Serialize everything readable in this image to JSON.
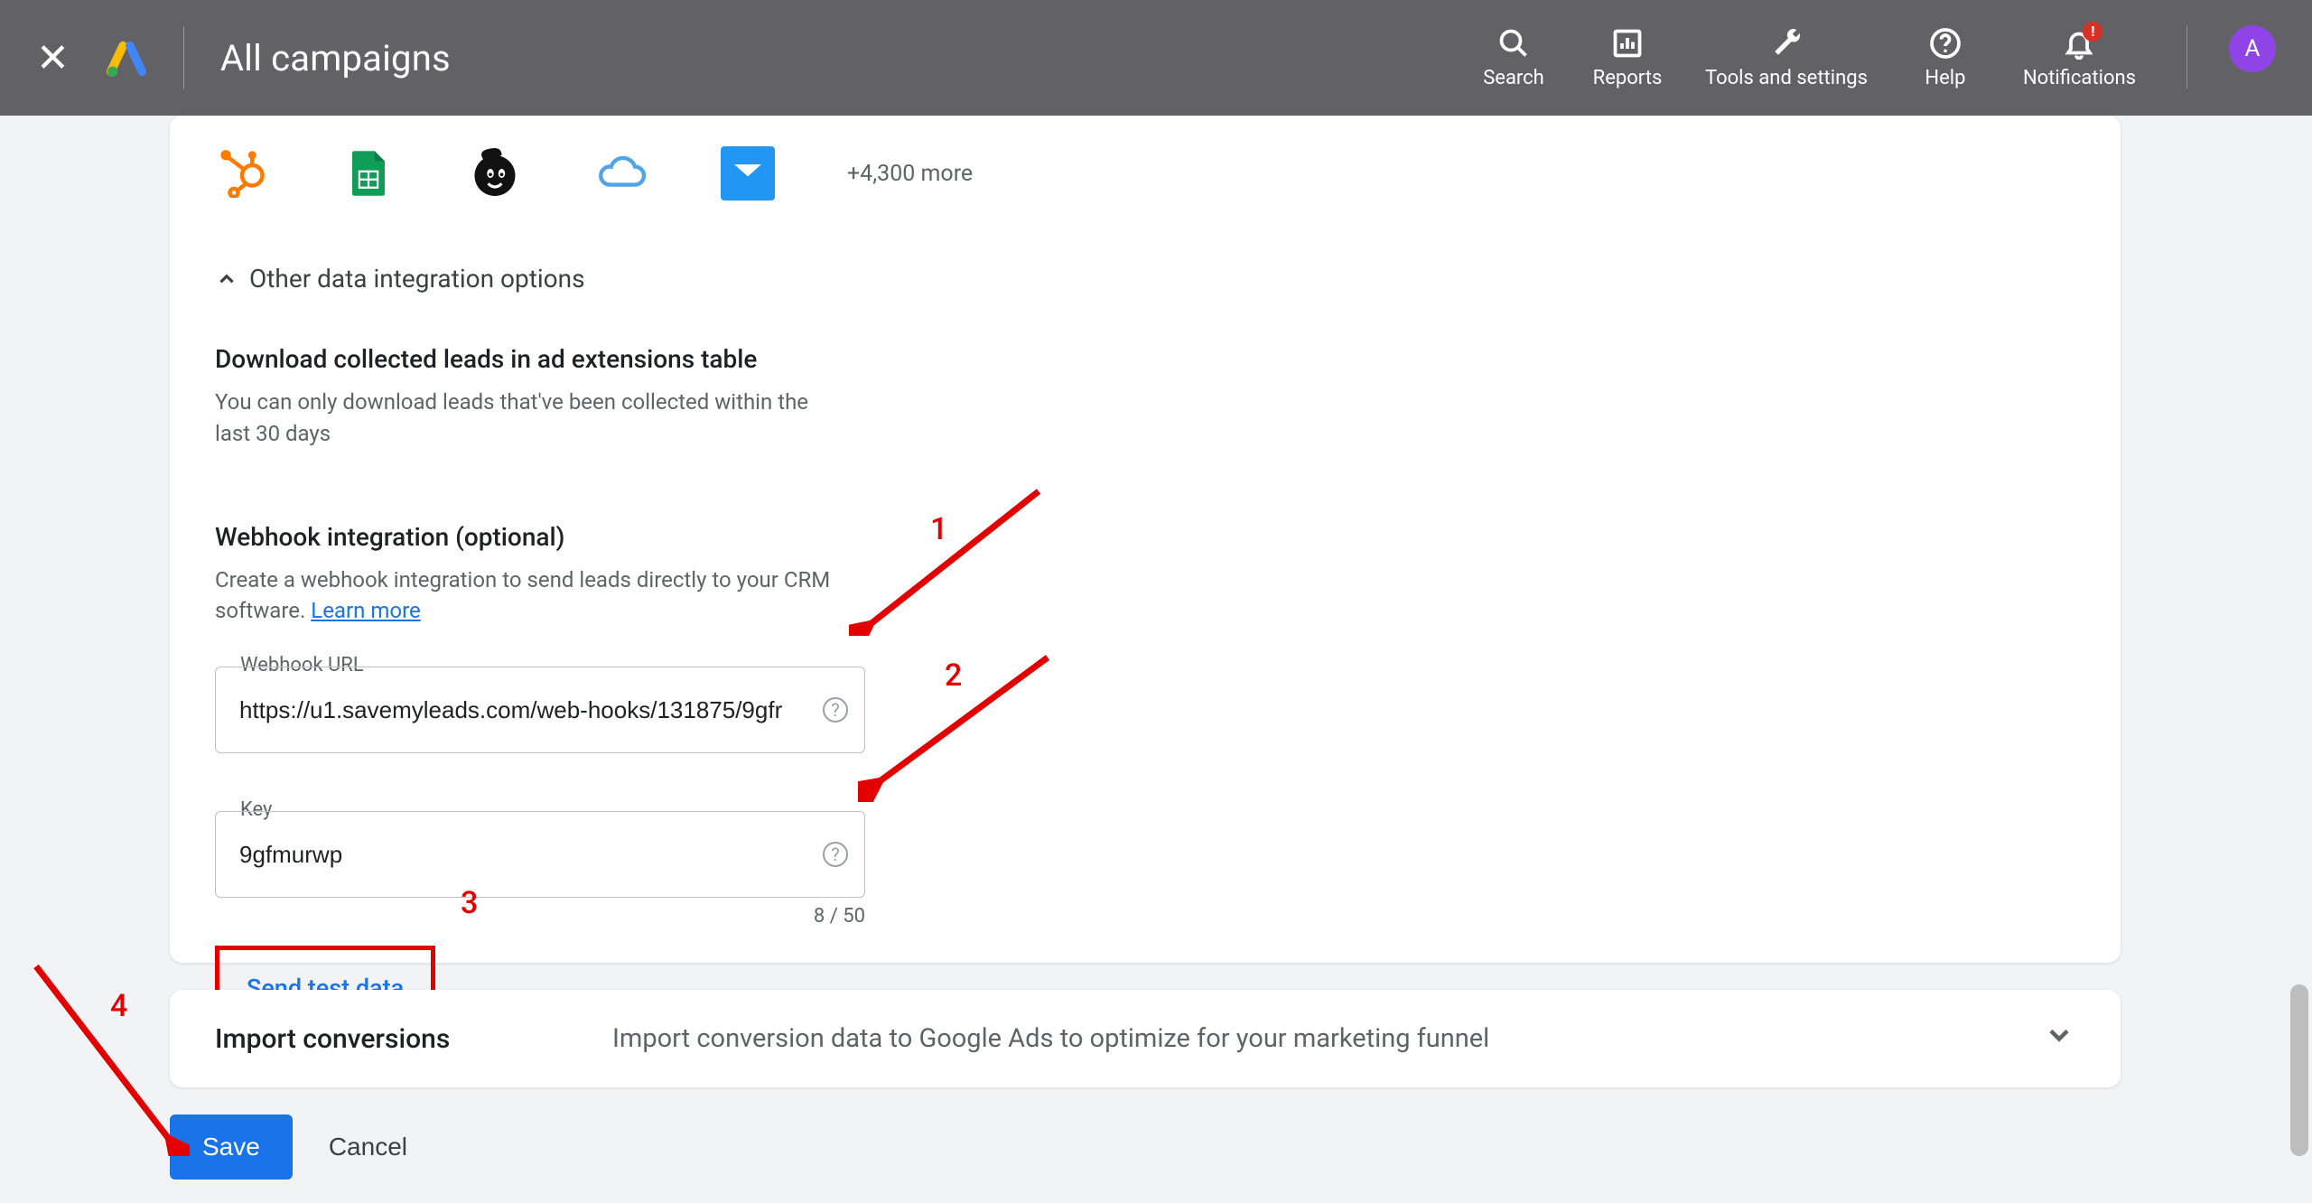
{
  "header": {
    "title": "All campaigns",
    "tools": {
      "search": "Search",
      "reports": "Reports",
      "tools_settings": "Tools and settings",
      "help": "Help",
      "notifications": "Notifications",
      "notif_badge": "!"
    },
    "avatar_initial": "A"
  },
  "integrations": {
    "more_text": "+4,300 more"
  },
  "toggle": {
    "label": "Other data integration options"
  },
  "download_section": {
    "title": "Download collected leads in ad extensions table",
    "desc": "You can only download leads that've been collected within the last 30 days"
  },
  "webhook_section": {
    "title": "Webhook integration (optional)",
    "desc_prefix": "Create a webhook integration to send leads directly to your CRM software. ",
    "learn_more": "Learn more",
    "url_label": "Webhook URL",
    "url_value": "https://u1.savemyleads.com/web-hooks/131875/9gfr",
    "key_label": "Key",
    "key_value": "9gfmurwp",
    "key_counter": "8 / 50",
    "send_test": "Send test data"
  },
  "import_card": {
    "title": "Import conversions",
    "desc": "Import conversion data to Google Ads to optimize for your marketing funnel"
  },
  "footer": {
    "save": "Save",
    "cancel": "Cancel"
  },
  "annotations": {
    "n1": "1",
    "n2": "2",
    "n3": "3",
    "n4": "4"
  }
}
